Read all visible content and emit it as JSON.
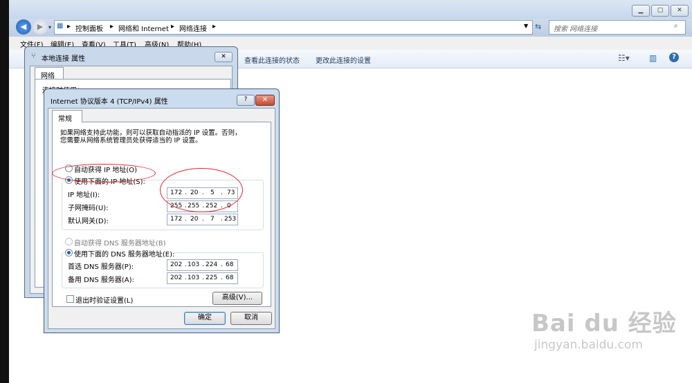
{
  "explorer": {
    "breadcrumb": [
      "控制面板",
      "网络和 Internet",
      "网络连接"
    ],
    "search_placeholder": "搜索 网络连接",
    "menu": [
      "文件(F)",
      "编辑(E)",
      "查看(V)",
      "工具(T)",
      "高级(N)",
      "帮助(H)"
    ],
    "commands": [
      "查看此连接的状态",
      "更改此连接的设置"
    ]
  },
  "lac_dialog": {
    "title": "本地连接 属性",
    "tab": "网络",
    "partial_label": "连接时使用："
  },
  "ipv4_dialog": {
    "title": "Internet 协议版本 4 (TCP/IPv4) 属性",
    "tab": "常规",
    "desc_line1": "如果网络支持此功能，则可以获取自动指派的 IP 设置。否则，",
    "desc_line2": "您需要从网络系统管理员处获得适当的 IP 设置。",
    "radio_auto_ip": "自动获得 IP 地址(O)",
    "radio_manual_ip": "使用下面的 IP 地址(S):",
    "ip_label": "IP 地址(I):",
    "subnet_label": "子网掩码(U):",
    "gateway_label": "默认网关(D):",
    "ip": [
      "172",
      "20",
      "5",
      "73"
    ],
    "subnet": [
      "255",
      "255",
      "252",
      "0"
    ],
    "gateway": [
      "172",
      "20",
      "7",
      "253"
    ],
    "radio_auto_dns": "自动获得 DNS 服务器地址(B)",
    "radio_manual_dns": "使用下面的 DNS 服务器地址(E):",
    "dns1_label": "首选 DNS 服务器(P):",
    "dns2_label": "备用 DNS 服务器(A):",
    "dns1": [
      "202",
      "103",
      "224",
      "68"
    ],
    "dns2": [
      "202",
      "103",
      "225",
      "68"
    ],
    "validate_label": "退出时验证设置(L)",
    "advanced_button": "高级(V)...",
    "ok_button": "确定",
    "cancel_button": "取消"
  },
  "watermark": {
    "brand": "Bai du 经验",
    "url": "jingyan.baidu.com"
  },
  "colors": {
    "annotation": "#e3232f",
    "selection": "#1d5fb8"
  }
}
